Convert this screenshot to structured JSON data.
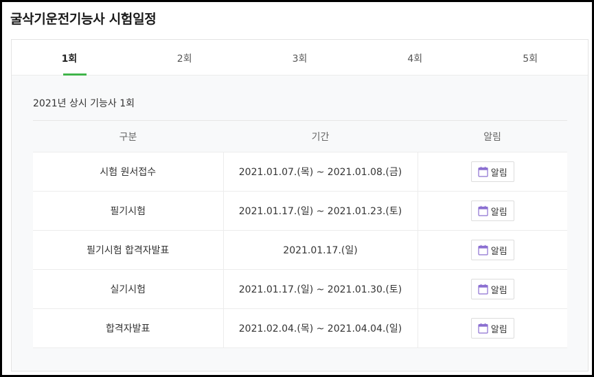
{
  "page": {
    "title": "굴삭기운전기능사 시험일정"
  },
  "tabs": [
    {
      "label": "1회",
      "active": true
    },
    {
      "label": "2회",
      "active": false
    },
    {
      "label": "3회",
      "active": false
    },
    {
      "label": "4회",
      "active": false
    },
    {
      "label": "5회",
      "active": false
    }
  ],
  "section": {
    "title": "2021년 상시 기능사 1회"
  },
  "table": {
    "headers": {
      "name": "구분",
      "period": "기간",
      "alarm": "알림"
    },
    "rows": [
      {
        "name": "시험 원서접수",
        "period": "2021.01.07.(목) ~ 2021.01.08.(금)",
        "alarm_label": "알림"
      },
      {
        "name": "필기시험",
        "period": "2021.01.17.(일) ~ 2021.01.23.(토)",
        "alarm_label": "알림"
      },
      {
        "name": "필기시험 합격자발표",
        "period": "2021.01.17.(일)",
        "alarm_label": "알림"
      },
      {
        "name": "실기시험",
        "period": "2021.01.17.(일) ~ 2021.01.30.(토)",
        "alarm_label": "알림"
      },
      {
        "name": "합격자발표",
        "period": "2021.02.04.(목) ~ 2021.04.04.(일)",
        "alarm_label": "알림"
      }
    ]
  },
  "icons": {
    "alarm": "calendar-icon"
  },
  "colors": {
    "active_tab_underline": "#3fb449",
    "calendar_icon": "#8b6fd1"
  }
}
